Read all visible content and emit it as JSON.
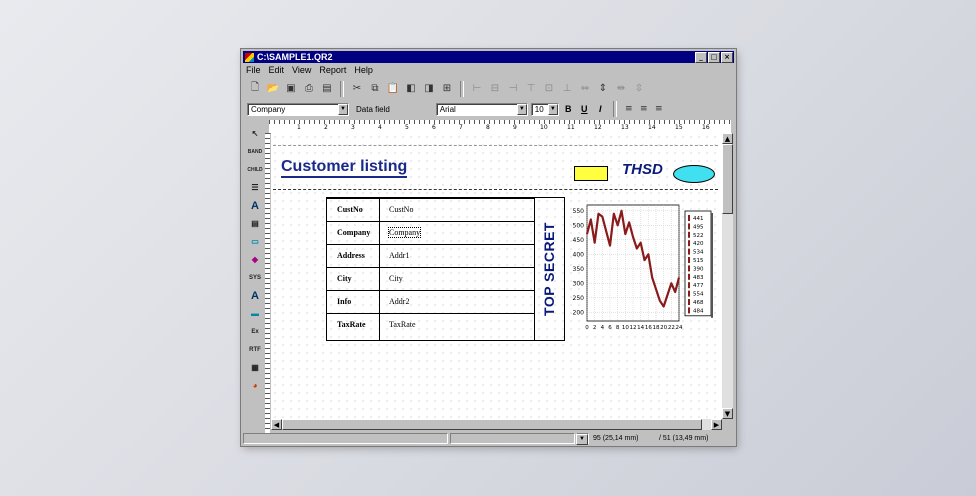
{
  "window": {
    "title": "C:\\SAMPLE1.QR2"
  },
  "menu": [
    "File",
    "Edit",
    "View",
    "Report",
    "Help"
  ],
  "toolbar2": {
    "component": "Company",
    "field_label": "Data field",
    "font": "Arial",
    "size": "10",
    "bold": "B",
    "underline": "U",
    "italic": "I"
  },
  "ruler_numbers": [
    "1",
    "2",
    "3",
    "4",
    "5",
    "6",
    "7",
    "8",
    "9",
    "10",
    "11",
    "12",
    "13",
    "14",
    "15",
    "16"
  ],
  "report": {
    "title": "Customer listing",
    "logo": "THSD",
    "watermark": "TOP SECRET",
    "rows": [
      {
        "label": "CustNo",
        "field": "CustNo"
      },
      {
        "label": "Company",
        "field": "Company"
      },
      {
        "label": "Address",
        "field": "Addr1"
      },
      {
        "label": "City",
        "field": "City"
      },
      {
        "label": "Info",
        "field": "Addr2"
      },
      {
        "label": "TaxRate",
        "field": "TaxRate"
      }
    ]
  },
  "chart_data": {
    "type": "line",
    "x": [
      0,
      1,
      2,
      3,
      4,
      5,
      6,
      7,
      8,
      9,
      10,
      11,
      12,
      13,
      14,
      15,
      16,
      17,
      18,
      19,
      20,
      21,
      22,
      23,
      24
    ],
    "values": [
      470,
      520,
      440,
      540,
      530,
      480,
      430,
      540,
      500,
      550,
      470,
      510,
      460,
      420,
      440,
      380,
      400,
      320,
      280,
      240,
      220,
      260,
      300,
      270,
      320
    ],
    "y_ticks": [
      "550",
      "500",
      "450",
      "400",
      "350",
      "300",
      "250",
      "200"
    ],
    "x_ticks": [
      "0",
      "2",
      "4",
      "6",
      "8",
      "10",
      "12",
      "14",
      "16",
      "18",
      "20",
      "22",
      "24"
    ],
    "ylim": [
      170,
      570
    ],
    "xlim": [
      0,
      24
    ],
    "legend": [
      "441",
      "495",
      "522",
      "420",
      "534",
      "515",
      "390",
      "483",
      "477",
      "554",
      "468",
      "484"
    ],
    "line_color": "#8b1a1a",
    "grid": true
  },
  "status": {
    "pos_x": "95 (25,14 mm)",
    "pos_y": "/ 51 (13,49 mm)"
  },
  "colors": {
    "title_bar": "#000080",
    "accent": "#1a2a8a"
  }
}
